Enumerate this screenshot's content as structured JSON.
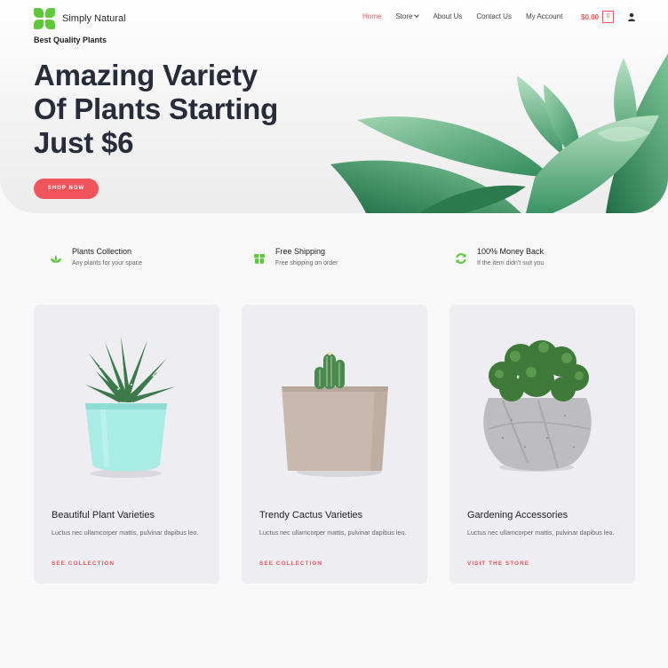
{
  "brand": {
    "name": "Simply Natural",
    "accent": "#f2545b",
    "logo_color": "#5cc83a"
  },
  "nav": {
    "items": [
      {
        "label": "Home",
        "active": true
      },
      {
        "label": "Store",
        "has_dropdown": true
      },
      {
        "label": "About Us"
      },
      {
        "label": "Contact Us"
      },
      {
        "label": "My Account"
      }
    ],
    "cart_total": "$0.00",
    "cart_count": "0",
    "user_icon": "user-icon"
  },
  "hero": {
    "eyebrow": "Best Quality Plants",
    "title_lines": [
      "Amazing Variety",
      "Of Plants Starting",
      "Just $6"
    ],
    "button": "SHOP NOW"
  },
  "features": [
    {
      "icon": "plant-icon",
      "title": "Plants Collection",
      "subtitle": "Any plants for your space"
    },
    {
      "icon": "box-icon",
      "title": "Free Shipping",
      "subtitle": "Free shipping on order"
    },
    {
      "icon": "refresh-icon",
      "title": "100% Money Back",
      "subtitle": "If the item didn't suit you"
    }
  ],
  "cards": [
    {
      "title": "Beautiful Plant Varieties",
      "description": "Luctus nec ullamcorper mattis, pulvinar dapibus leo.",
      "link": "SEE COLLECTION"
    },
    {
      "title": "Trendy Cactus Varieties",
      "description": "Luctus nec ullamcorper mattis, pulvinar dapibus leo.",
      "link": "SEE COLLECTION"
    },
    {
      "title": "Gardening Accessories",
      "description": "Luctus nec ullamcorper mattis, pulvinar dapibus leo.",
      "link": "VISIT THE STORE"
    }
  ]
}
